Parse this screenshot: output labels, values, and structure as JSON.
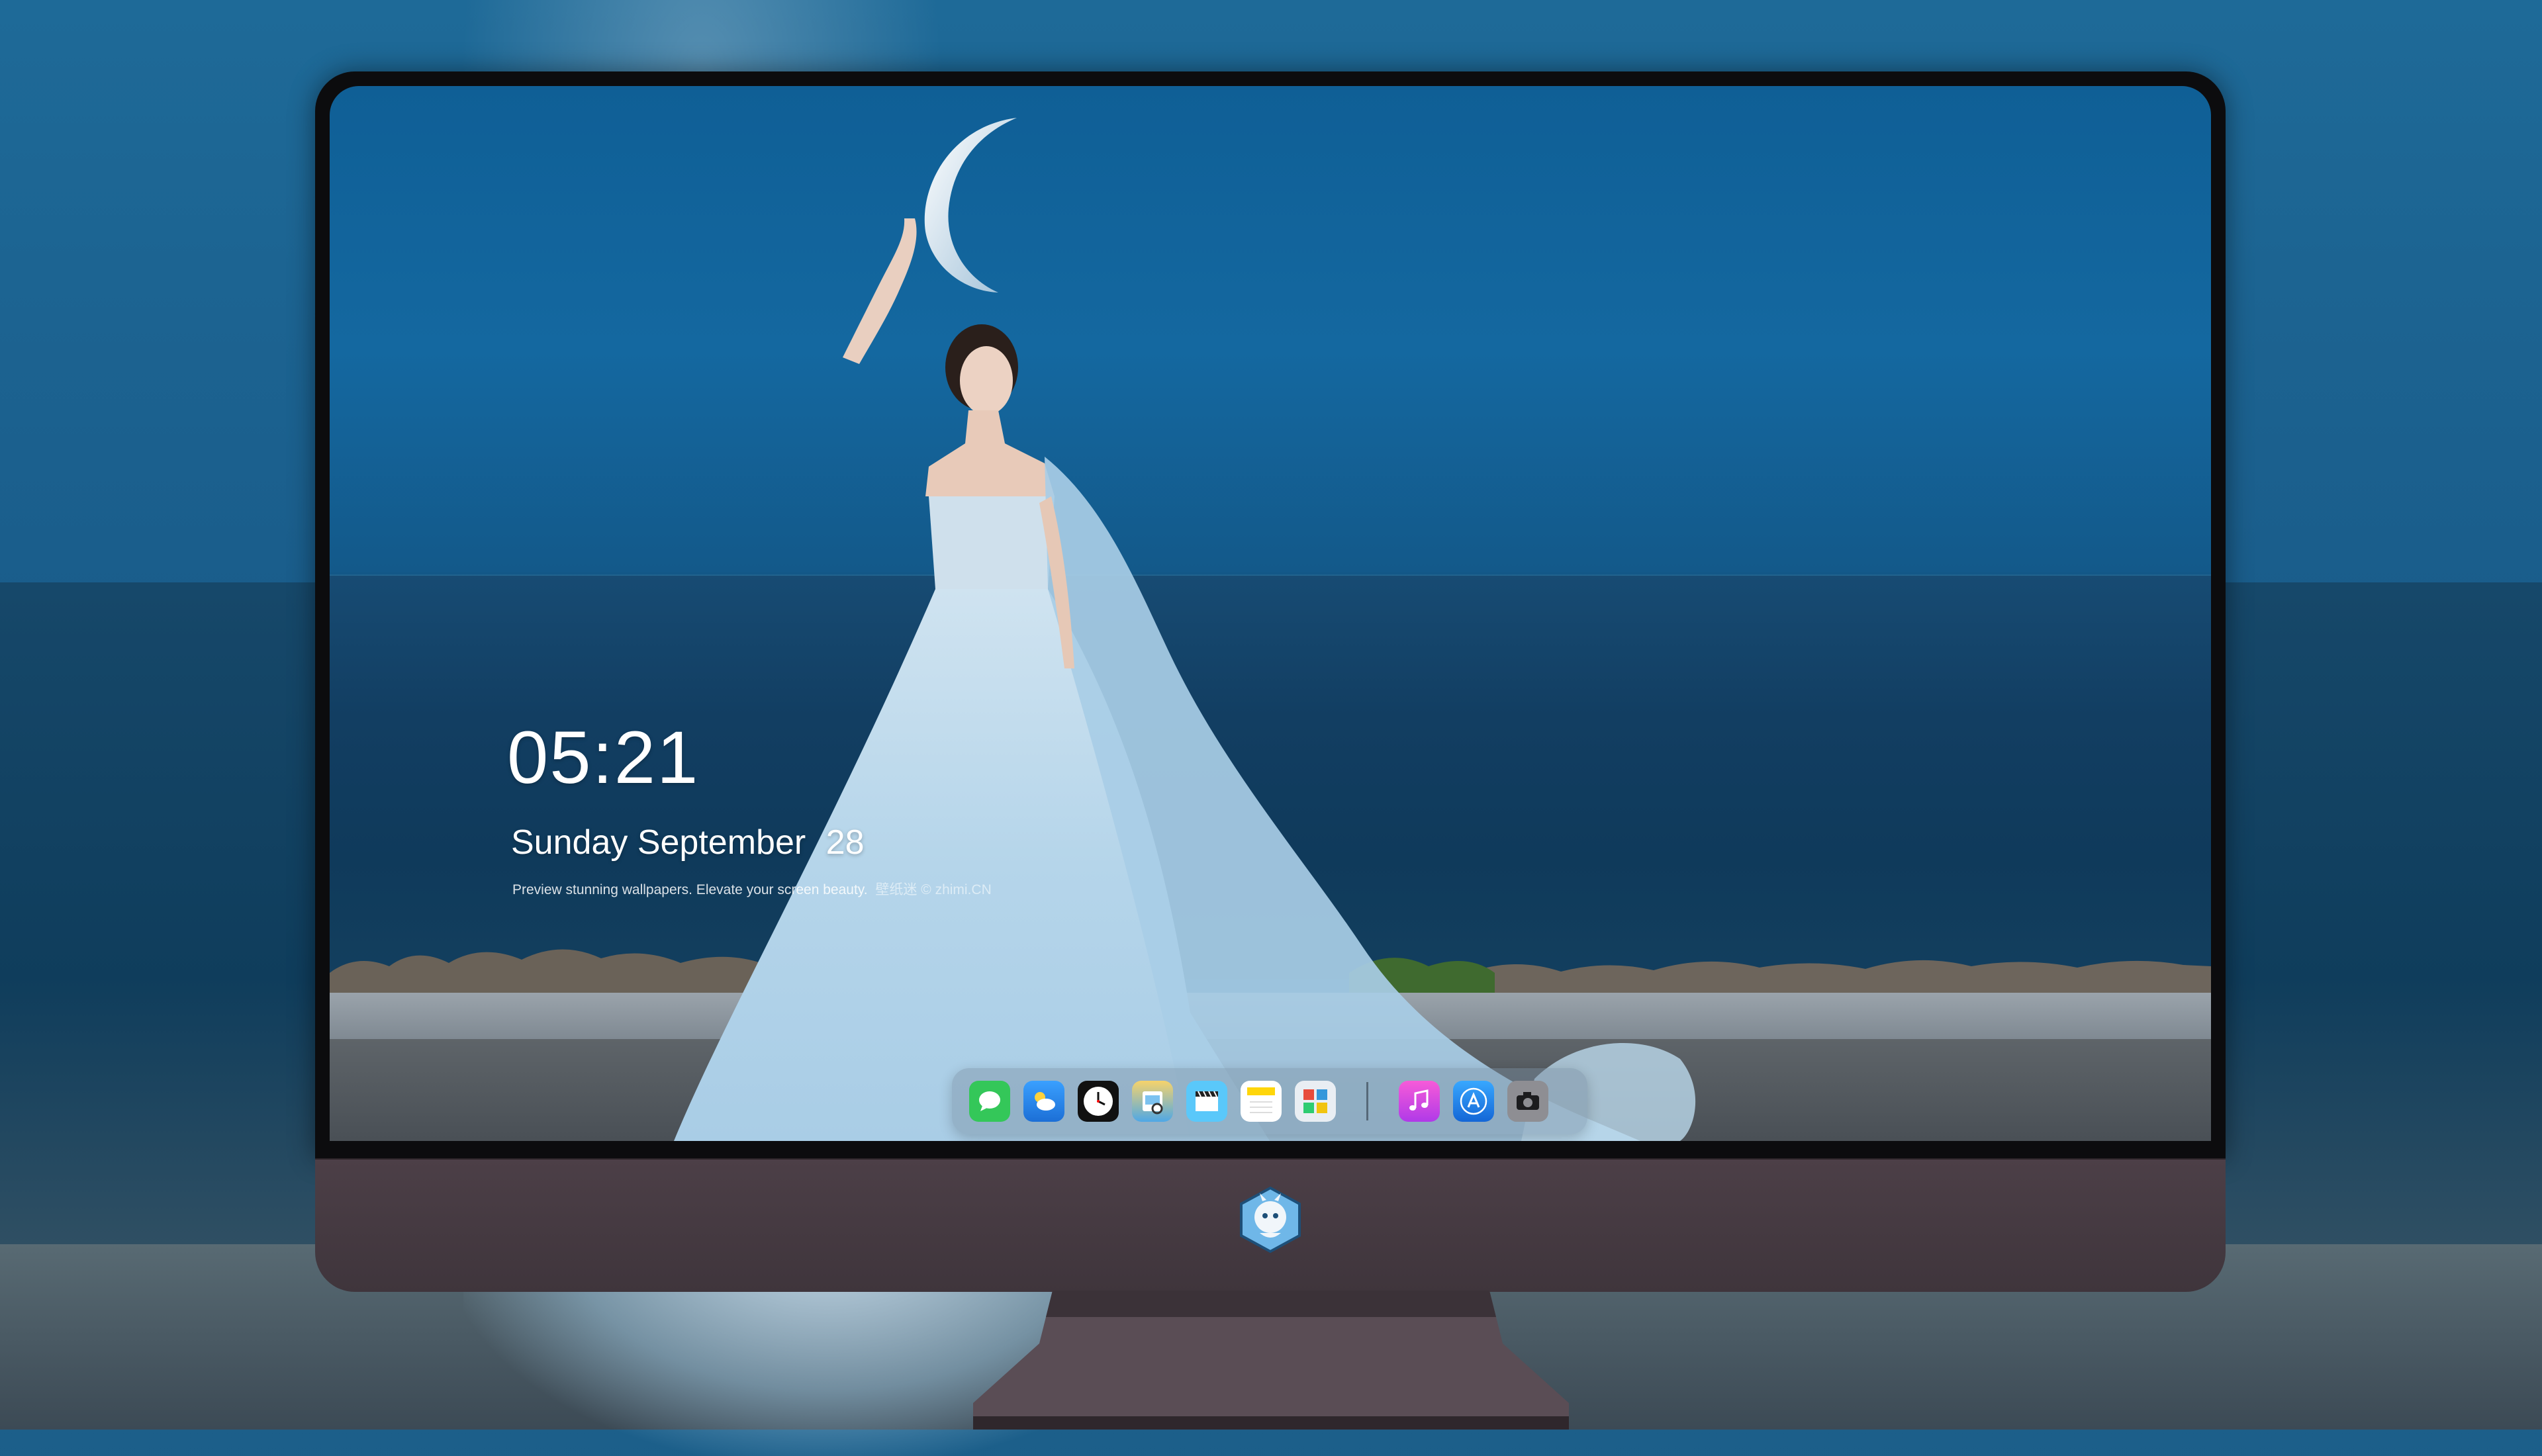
{
  "lock_screen": {
    "time": "05:21",
    "weekday": "Sunday",
    "month": "September",
    "day": "28",
    "caption": "Preview stunning wallpapers. Elevate your screen beauty.",
    "caption_source": "壁纸迷 © zhimi.CN"
  },
  "dock": {
    "apps": [
      {
        "name": "Messages",
        "icon": "message-bubble-icon",
        "color": "#34c759"
      },
      {
        "name": "Weather",
        "icon": "weather-cloud-sun-icon",
        "color": "#2f8ff0"
      },
      {
        "name": "Clock",
        "icon": "clock-icon",
        "color": "#111111"
      },
      {
        "name": "Preview",
        "icon": "preview-icon",
        "color": "#f2c14e"
      },
      {
        "name": "Clips",
        "icon": "clapperboard-icon",
        "color": "#5ac8fa"
      },
      {
        "name": "Notes",
        "icon": "notes-icon",
        "color": "#ffd60a"
      },
      {
        "name": "Photo Booth",
        "icon": "photo-gallery-icon",
        "color": "#e9eef3"
      },
      {
        "name": "iTunes",
        "icon": "music-note-icon",
        "color": "#e64ad6"
      },
      {
        "name": "App Store",
        "icon": "app-store-icon",
        "color": "#1b8df2"
      },
      {
        "name": "Camera",
        "icon": "camera-icon",
        "color": "#8e8e93"
      }
    ]
  },
  "device": {
    "logo_icon": "dragon-mascot-logo-icon",
    "bezel_color": "#0c0c0e",
    "chin_color": "#4a3d45"
  }
}
